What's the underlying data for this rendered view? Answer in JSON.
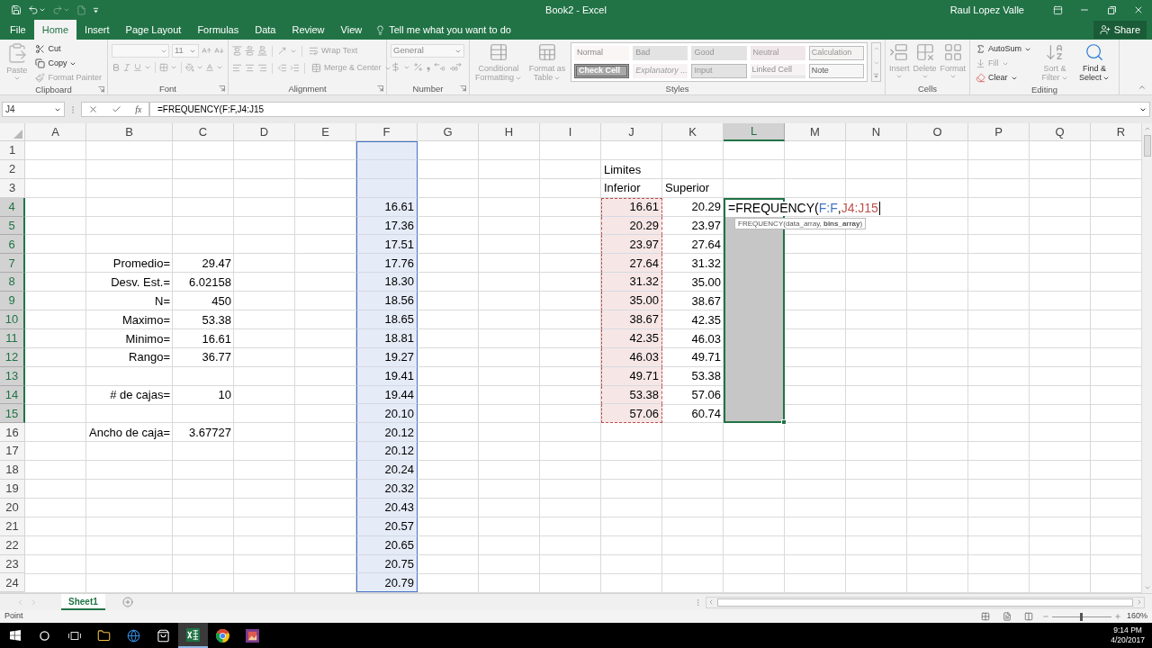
{
  "title_bar": {
    "quick_access": [
      {
        "disabled": false
      },
      {
        "disabled": false
      },
      {
        "disabled": true
      },
      {
        "disabled": true
      },
      {
        "disabled": false
      }
    ],
    "title": "Book2 - Excel",
    "user": "Raul Lopez Valle"
  },
  "tabs": [
    {
      "label": "File",
      "selected": false
    },
    {
      "label": "Home",
      "selected": true
    },
    {
      "label": "Insert",
      "selected": false
    },
    {
      "label": "Page Layout",
      "selected": false
    },
    {
      "label": "Formulas",
      "selected": false
    },
    {
      "label": "Data",
      "selected": false
    },
    {
      "label": "Review",
      "selected": false
    },
    {
      "label": "View",
      "selected": false
    }
  ],
  "tell_me": {
    "placeholder": "Tell me what you want to do"
  },
  "share": {
    "label": "Share"
  },
  "ribbon": {
    "clipboard": {
      "label": "Clipboard",
      "paste": {
        "label": "Paste",
        "disabled": true
      },
      "cut": {
        "label": "Cut",
        "disabled": false
      },
      "copy": {
        "label": "Copy",
        "disabled": false
      },
      "format_painter": {
        "label": "Format Painter",
        "disabled": true
      }
    },
    "font": {
      "label": "Font",
      "disabled": true,
      "size": {
        "value": "11"
      }
    },
    "alignment": {
      "label": "Alignment",
      "disabled": true,
      "wrap_text": {
        "label": "Wrap Text"
      },
      "merge_center": {
        "label": "Merge & Center"
      }
    },
    "number": {
      "label": "Number",
      "disabled": true,
      "format": {
        "value": "General"
      }
    },
    "styles": {
      "label": "Styles",
      "disabled": true,
      "conditional_formatting": {
        "label": "Conditional Formatting"
      },
      "format_as_table": {
        "label": "Format as Table"
      },
      "gallery": [
        {
          "label": "Normal",
          "kind": "normal"
        },
        {
          "label": "Bad",
          "kind": "bad"
        },
        {
          "label": "Good",
          "kind": "good"
        },
        {
          "label": "Neutral",
          "kind": "neutral"
        },
        {
          "label": "Calculation",
          "kind": "calculation"
        },
        {
          "label": "Check Cell",
          "kind": "check"
        },
        {
          "label": "Explanatory ...",
          "kind": "explanatory"
        },
        {
          "label": "Input",
          "kind": "input"
        },
        {
          "label": "Linked Cell",
          "kind": "linked"
        },
        {
          "label": "Note",
          "kind": "note"
        }
      ]
    },
    "cells": {
      "label": "Cells",
      "disabled": true,
      "insert": {
        "label": "Insert"
      },
      "delete": {
        "label": "Delete"
      },
      "format": {
        "label": "Format"
      }
    },
    "editing": {
      "label": "Editing",
      "autosum": {
        "label": "AutoSum",
        "disabled": false
      },
      "fill": {
        "label": "Fill",
        "disabled": true
      },
      "clear": {
        "label": "Clear",
        "disabled": false
      },
      "sort_filter": {
        "label": "Sort & Filter",
        "disabled": true
      },
      "find_select": {
        "label": "Find & Select",
        "disabled": false
      }
    }
  },
  "formula_bar": {
    "name_box": {
      "value": "J4"
    },
    "function_label": "fx",
    "formula": {
      "value": "=FREQUENCY(F:F,J4:J15"
    }
  },
  "sheet": {
    "columns": [
      {
        "label": "A",
        "selected": false
      },
      {
        "label": "B",
        "selected": false
      },
      {
        "label": "C",
        "selected": false
      },
      {
        "label": "D",
        "selected": false
      },
      {
        "label": "E",
        "selected": false
      },
      {
        "label": "F",
        "selected": false,
        "color": "#4472c4"
      },
      {
        "label": "G",
        "selected": false
      },
      {
        "label": "H",
        "selected": false
      },
      {
        "label": "I",
        "selected": false
      },
      {
        "label": "J",
        "selected": false
      },
      {
        "label": "K",
        "selected": false
      },
      {
        "label": "L",
        "selected": true
      },
      {
        "label": "M",
        "selected": false
      },
      {
        "label": "N",
        "selected": false
      },
      {
        "label": "O",
        "selected": false
      },
      {
        "label": "P",
        "selected": false
      },
      {
        "label": "Q",
        "selected": false
      },
      {
        "label": "R",
        "selected": false
      }
    ],
    "rows": [
      {
        "number": "1",
        "selected": false
      },
      {
        "number": "2",
        "selected": false,
        "cells": {
          "col_j": {
            "text": "Limites",
            "kind": "text"
          }
        }
      },
      {
        "number": "3",
        "selected": false,
        "cells": {
          "col_j": {
            "text": "Inferior",
            "kind": "text"
          },
          "col_k": {
            "text": "Superior",
            "kind": "text"
          }
        }
      },
      {
        "number": "4",
        "selected": true,
        "cells": {
          "col_f": {
            "text": "16.61",
            "kind": "number"
          },
          "col_j": {
            "text": "16.61",
            "kind": "number",
            "color": "#c0504d"
          },
          "col_k": {
            "text": "20.29",
            "kind": "number"
          },
          "col_l": {
            "kind": "editor",
            "parts": [
              {
                "text": "=FREQUENCY("
              },
              {
                "text": "F:F",
                "color": "#4472c4"
              },
              {
                "text": ","
              },
              {
                "text": "J4:J15",
                "color": "#c0504d"
              }
            ],
            "tooltip": "FREQUENCY(data_array, **bins_array**)"
          }
        }
      },
      {
        "number": "5",
        "selected": true,
        "cells": {
          "col_f": {
            "text": "17.36",
            "kind": "number"
          },
          "col_j": {
            "text": "20.29",
            "kind": "number",
            "color": "#c0504d"
          },
          "col_k": {
            "text": "23.97",
            "kind": "number"
          }
        }
      },
      {
        "number": "6",
        "selected": true,
        "cells": {
          "col_f": {
            "text": "17.51",
            "kind": "number"
          },
          "col_j": {
            "text": "23.97",
            "kind": "number",
            "color": "#c0504d"
          },
          "col_k": {
            "text": "27.64",
            "kind": "number"
          }
        }
      },
      {
        "number": "7",
        "selected": true,
        "cells": {
          "col_b": {
            "text": "Promedio=",
            "kind": "label"
          },
          "col_c": {
            "text": "29.47",
            "kind": "number"
          },
          "col_f": {
            "text": "17.76",
            "kind": "number"
          },
          "col_j": {
            "text": "27.64",
            "kind": "number",
            "color": "#c0504d"
          },
          "col_k": {
            "text": "31.32",
            "kind": "number"
          }
        }
      },
      {
        "number": "8",
        "selected": true,
        "cells": {
          "col_b": {
            "text": "Desv. Est.=",
            "kind": "label"
          },
          "col_c": {
            "text": "6.02158",
            "kind": "number"
          },
          "col_f": {
            "text": "18.30",
            "kind": "number"
          },
          "col_j": {
            "text": "31.32",
            "kind": "number",
            "color": "#c0504d"
          },
          "col_k": {
            "text": "35.00",
            "kind": "number"
          }
        }
      },
      {
        "number": "9",
        "selected": true,
        "cells": {
          "col_b": {
            "text": "N=",
            "kind": "label"
          },
          "col_c": {
            "text": "450",
            "kind": "number"
          },
          "col_f": {
            "text": "18.56",
            "kind": "number"
          },
          "col_j": {
            "text": "35.00",
            "kind": "number",
            "color": "#c0504d"
          },
          "col_k": {
            "text": "38.67",
            "kind": "number"
          }
        }
      },
      {
        "number": "10",
        "selected": true,
        "cells": {
          "col_b": {
            "text": "Maximo=",
            "kind": "label"
          },
          "col_c": {
            "text": "53.38",
            "kind": "number"
          },
          "col_f": {
            "text": "18.65",
            "kind": "number"
          },
          "col_j": {
            "text": "38.67",
            "kind": "number",
            "color": "#c0504d"
          },
          "col_k": {
            "text": "42.35",
            "kind": "number"
          }
        }
      },
      {
        "number": "11",
        "selected": true,
        "cells": {
          "col_b": {
            "text": "Minimo=",
            "kind": "label"
          },
          "col_c": {
            "text": "16.61",
            "kind": "number"
          },
          "col_f": {
            "text": "18.81",
            "kind": "number"
          },
          "col_j": {
            "text": "42.35",
            "kind": "number",
            "color": "#c0504d"
          },
          "col_k": {
            "text": "46.03",
            "kind": "number"
          }
        }
      },
      {
        "number": "12",
        "selected": true,
        "cells": {
          "col_b": {
            "text": "Rango=",
            "kind": "label"
          },
          "col_c": {
            "text": "36.77",
            "kind": "number"
          },
          "col_f": {
            "text": "19.27",
            "kind": "number"
          },
          "col_j": {
            "text": "46.03",
            "kind": "number",
            "color": "#c0504d"
          },
          "col_k": {
            "text": "49.71",
            "kind": "number"
          }
        }
      },
      {
        "number": "13",
        "selected": true,
        "cells": {
          "col_f": {
            "text": "19.41",
            "kind": "number"
          },
          "col_j": {
            "text": "49.71",
            "kind": "number",
            "color": "#c0504d"
          },
          "col_k": {
            "text": "53.38",
            "kind": "number"
          }
        }
      },
      {
        "number": "14",
        "selected": true,
        "cells": {
          "col_b": {
            "text": "# de cajas=",
            "kind": "label"
          },
          "col_c": {
            "text": "10",
            "kind": "number"
          },
          "col_f": {
            "text": "19.44",
            "kind": "number"
          },
          "col_j": {
            "text": "53.38",
            "kind": "number",
            "color": "#c0504d"
          },
          "col_k": {
            "text": "57.06",
            "kind": "number"
          }
        }
      },
      {
        "number": "15",
        "selected": true,
        "cells": {
          "col_f": {
            "text": "20.10",
            "kind": "number"
          },
          "col_j": {
            "text": "57.06",
            "kind": "number",
            "color": "#c0504d"
          },
          "col_k": {
            "text": "60.74",
            "kind": "number"
          }
        }
      },
      {
        "number": "16",
        "selected": false,
        "cells": {
          "col_b": {
            "text": "Ancho de caja=",
            "kind": "label"
          },
          "col_c": {
            "text": "3.67727",
            "kind": "number"
          },
          "col_f": {
            "text": "20.12",
            "kind": "number"
          }
        }
      },
      {
        "number": "17",
        "selected": false,
        "cells": {
          "col_f": {
            "text": "20.12",
            "kind": "number"
          }
        }
      },
      {
        "number": "18",
        "selected": false,
        "cells": {
          "col_f": {
            "text": "20.24",
            "kind": "number"
          }
        }
      },
      {
        "number": "19",
        "selected": false,
        "cells": {
          "col_f": {
            "text": "20.32",
            "kind": "number"
          }
        }
      },
      {
        "number": "20",
        "selected": false,
        "cells": {
          "col_f": {
            "text": "20.43",
            "kind": "number"
          }
        }
      },
      {
        "number": "21",
        "selected": false,
        "cells": {
          "col_f": {
            "text": "20.57",
            "kind": "number"
          }
        }
      },
      {
        "number": "22",
        "selected": false,
        "cells": {
          "col_f": {
            "text": "20.65",
            "kind": "number"
          }
        }
      },
      {
        "number": "23",
        "selected": false,
        "cells": {
          "col_f": {
            "text": "20.75",
            "kind": "number"
          }
        }
      },
      {
        "number": "24",
        "selected": false,
        "cells": {
          "col_f": {
            "text": "20.79",
            "kind": "number"
          }
        }
      }
    ]
  },
  "sheet_tabs": [
    {
      "label": "Sheet1",
      "selected": true
    }
  ],
  "status_bar": {
    "mode": "Point",
    "zoom": {
      "level": 0.5,
      "reading": "160%"
    }
  },
  "taskbar": {
    "apps": [
      {
        "selected": false
      },
      {
        "selected": false
      },
      {
        "selected": false
      },
      {
        "selected": true
      },
      {
        "selected": false
      },
      {
        "selected": false
      }
    ],
    "clock": {
      "time": "9:14 PM",
      "date": "4/20/2017"
    }
  }
}
